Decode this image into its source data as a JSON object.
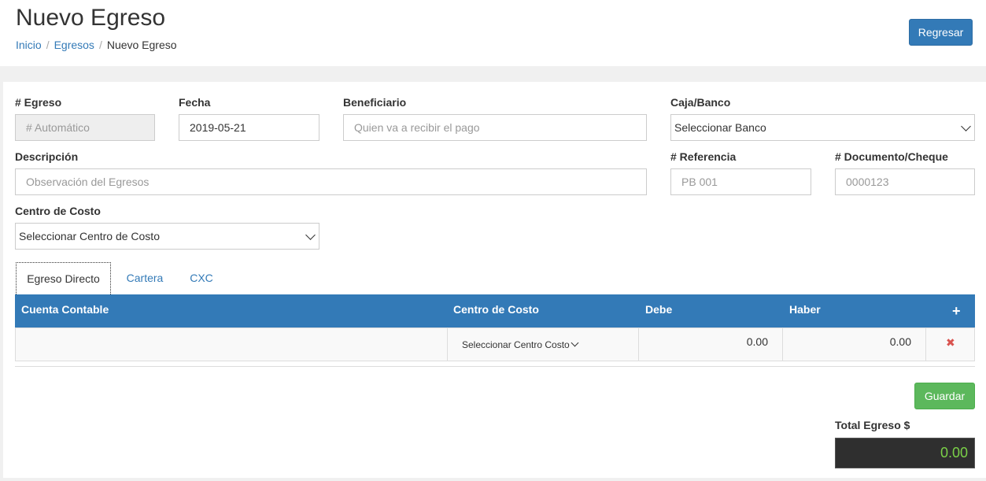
{
  "header": {
    "title": "Nuevo Egreso",
    "breadcrumb": [
      "Inicio",
      "Egresos",
      "Nuevo Egreso"
    ],
    "back_button": "Regresar"
  },
  "form": {
    "egreso": {
      "label": "# Egreso",
      "placeholder": "# Automático"
    },
    "fecha": {
      "label": "Fecha",
      "value": "2019-05-21"
    },
    "beneficiario": {
      "label": "Beneficiario",
      "placeholder": "Quien va a recibir el pago"
    },
    "caja_banco": {
      "label": "Caja/Banco",
      "selected": "Seleccionar Banco"
    },
    "descripcion": {
      "label": "Descripción",
      "placeholder": "Observación del Egresos"
    },
    "referencia": {
      "label": "# Referencia",
      "placeholder": "PB 001"
    },
    "documento": {
      "label": "# Documento/Cheque",
      "placeholder": "0000123"
    },
    "centro_costo": {
      "label": "Centro de Costo",
      "selected": "Seleccionar Centro de Costo"
    }
  },
  "tabs": [
    {
      "label": "Egreso Directo",
      "active": true
    },
    {
      "label": "Cartera",
      "active": false
    },
    {
      "label": "CXC",
      "active": false
    }
  ],
  "table": {
    "headers": [
      "Cuenta Contable",
      "Centro de Costo",
      "Debe",
      "Haber"
    ],
    "add_icon": "plus-icon",
    "rows": [
      {
        "cuenta": "",
        "centro": "Seleccionar Centro Costo",
        "debe": "0.00",
        "haber": "0.00"
      }
    ]
  },
  "save_button": "Guardar",
  "total": {
    "label": "Total Egreso $",
    "value": "0.00"
  },
  "colors": {
    "primary": "#337ab7",
    "success": "#5cb85c",
    "danger": "#d9534f",
    "total_text": "#7bd148"
  }
}
